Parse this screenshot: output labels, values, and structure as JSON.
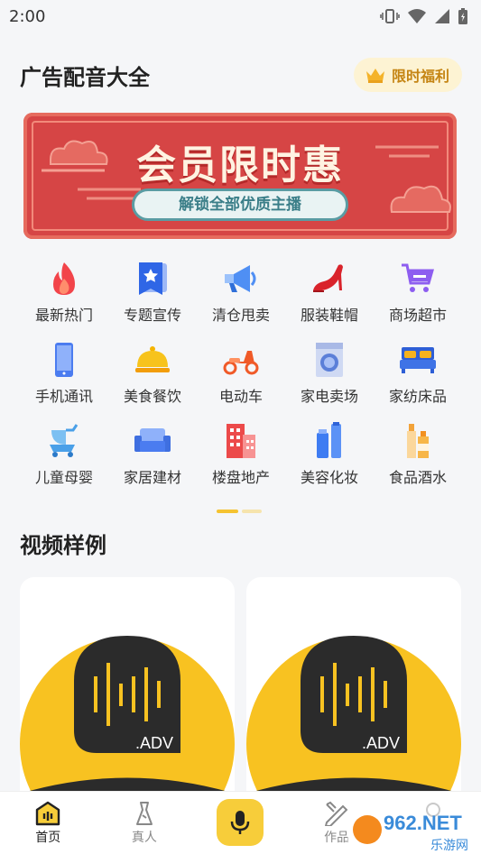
{
  "status": {
    "time": "2:00"
  },
  "header": {
    "title": "广告配音大全",
    "promo_label": "限时福利"
  },
  "banner": {
    "title": "会员限时惠",
    "subtitle": "解锁全部优质主播"
  },
  "categories": [
    {
      "label": "最新热门",
      "icon": "fire-icon"
    },
    {
      "label": "专题宣传",
      "icon": "star-bookmark-icon"
    },
    {
      "label": "清仓甩卖",
      "icon": "megaphone-icon"
    },
    {
      "label": "服装鞋帽",
      "icon": "high-heel-icon"
    },
    {
      "label": "商场超市",
      "icon": "shopping-cart-icon"
    },
    {
      "label": "手机通讯",
      "icon": "phone-icon"
    },
    {
      "label": "美食餐饮",
      "icon": "food-cloche-icon"
    },
    {
      "label": "电动车",
      "icon": "scooter-icon"
    },
    {
      "label": "家电卖场",
      "icon": "washing-machine-icon"
    },
    {
      "label": "家纺床品",
      "icon": "bed-icon"
    },
    {
      "label": "儿童母婴",
      "icon": "stroller-icon"
    },
    {
      "label": "家居建材",
      "icon": "sofa-icon"
    },
    {
      "label": "楼盘地产",
      "icon": "building-icon"
    },
    {
      "label": "美容化妆",
      "icon": "cosmetics-icon"
    },
    {
      "label": "食品酒水",
      "icon": "bottles-icon"
    }
  ],
  "section": {
    "title": "视频样例"
  },
  "video_cards": [
    {
      "badge": ".ADV"
    },
    {
      "badge": ".ADV"
    }
  ],
  "nav": {
    "home": "首页",
    "real_person": "真人",
    "works": "作品"
  },
  "watermark": {
    "text": "962.NET",
    "sub": "乐游网"
  },
  "colors": {
    "accent": "#f7cd3a",
    "banner_red": "#d64545",
    "promo_text": "#c58514"
  }
}
